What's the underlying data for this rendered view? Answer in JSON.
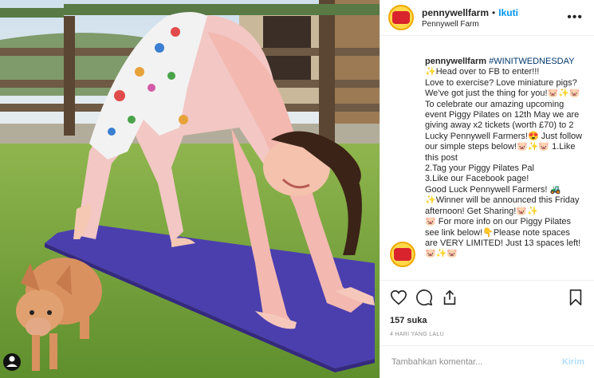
{
  "header": {
    "username": "pennywellfarm",
    "separator": "•",
    "follow_label": "Ikuti",
    "location": "Pennywell Farm",
    "more_label": "•••"
  },
  "avatar": {
    "logo_text": "Pennywell"
  },
  "caption": {
    "username": "pennywellfarm",
    "hashtag": "#WINITWEDNESDAY",
    "body": "✨Head over to FB to enter!!!\nLove to exercise? Love miniature pigs? We've got just the thing for you!🐷✨🐷 To celebrate our amazing upcoming event Piggy Pilates on 12th May we are giving away x2 tickets (worth £70) to 2 Lucky Pennywell Farmers!😍 Just follow our simple steps below!🐷✨🐷 1.Like this post\n2.Tag your Piggy Pilates Pal\n3.Like our Facebook page!\nGood Luck Pennywell Farmers! 🚜\n✨Winner will be announced this Friday afternoon! Get Sharing!🐷✨\n🐷 For more info on our Piggy Pilates see link below!👇Please note spaces are VERY LIMITED! Just 13 spaces left!\n🐷✨🐷"
  },
  "actions": {
    "likes": "157 suka",
    "time": "4 HARI YANG LALU"
  },
  "comment": {
    "placeholder": "Tambahkan komentar...",
    "post_label": "Kirim"
  },
  "colors": {
    "accent": "#0095f6",
    "post_disabled": "#b2dffc",
    "mat": "#4b3fae",
    "grass": "#6f9e3c"
  },
  "icons": [
    "heart-icon",
    "comment-icon",
    "share-icon",
    "bookmark-icon",
    "more-icon"
  ]
}
